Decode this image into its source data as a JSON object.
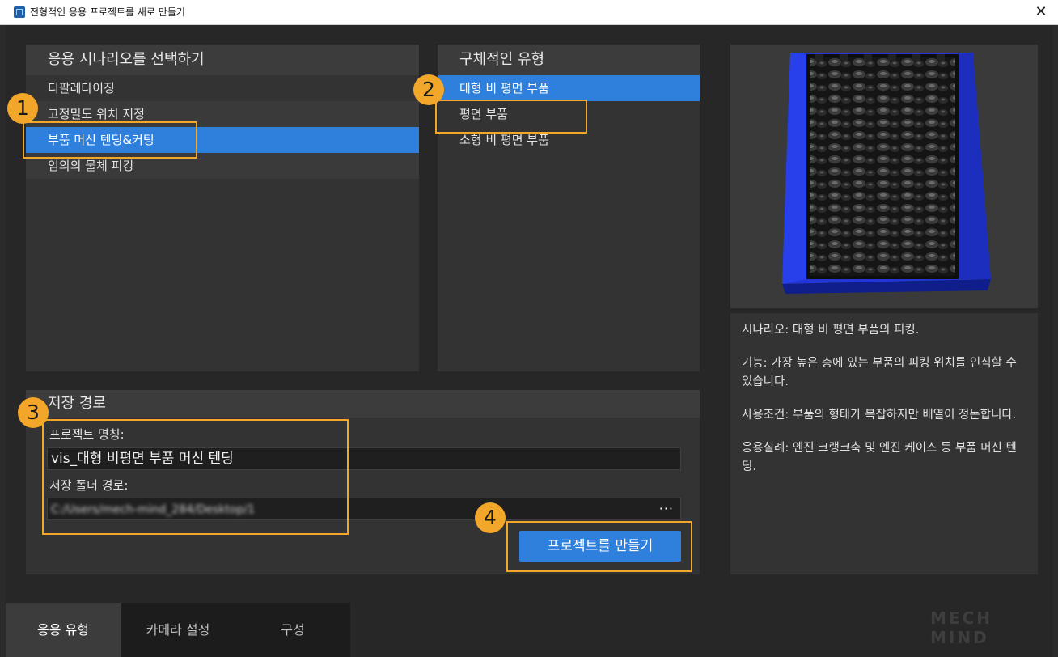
{
  "window": {
    "title": "전형적인 응용 프로젝트를 새로 만들기",
    "close_glyph": "✕"
  },
  "scenario": {
    "header": "응용 시나리오를 선택하기",
    "items": [
      {
        "label": "디팔레타이징"
      },
      {
        "label": "고정밀도 위치 지정"
      },
      {
        "label": "부품 머신 텐딩&커팅"
      },
      {
        "label": "임의의 물체 피킹"
      }
    ],
    "selected_index": 2
  },
  "types": {
    "header": "구체적인 유형",
    "items": [
      {
        "label": "대형 비 평면 부품"
      },
      {
        "label": "평면 부품"
      },
      {
        "label": "소형 비 평면 부품"
      }
    ],
    "selected_index": 0
  },
  "description": {
    "scenario": "시나리오:  대형 비 평면 부품의 피킹.",
    "function": "기능:  가장 높은 층에 있는 부품의 피킹 위치를 인식할 수 있습니다.",
    "conditions": "사용조건:  부품의 형태가 복잡하지만 배열이 정돈합니다.",
    "examples": "응용실례:  엔진 크랭크축 및 엔진 케이스 등 부품 머신 텐딩."
  },
  "save": {
    "header": "저장 경로",
    "project_name_label": "프로젝트 명칭:",
    "project_name_value": "vis_대형 비평면 부품 머신 텐딩",
    "folder_label": "저장 폴더 경로:",
    "folder_value": "C:/Users/mech-mind_284/Desktop/1",
    "browse_label": "···",
    "create_button": "프로젝트를 만들기"
  },
  "badges": [
    "1",
    "2",
    "3",
    "4"
  ],
  "tabs": [
    {
      "label": "응용 유형",
      "active": true
    },
    {
      "label": "카메라 설정",
      "active": false
    },
    {
      "label": "구성",
      "active": false
    }
  ],
  "watermark": "MECH MIND",
  "colors": {
    "accent": "#2f80dd",
    "highlight": "#f2a62a",
    "bin": "#1d35c4"
  }
}
